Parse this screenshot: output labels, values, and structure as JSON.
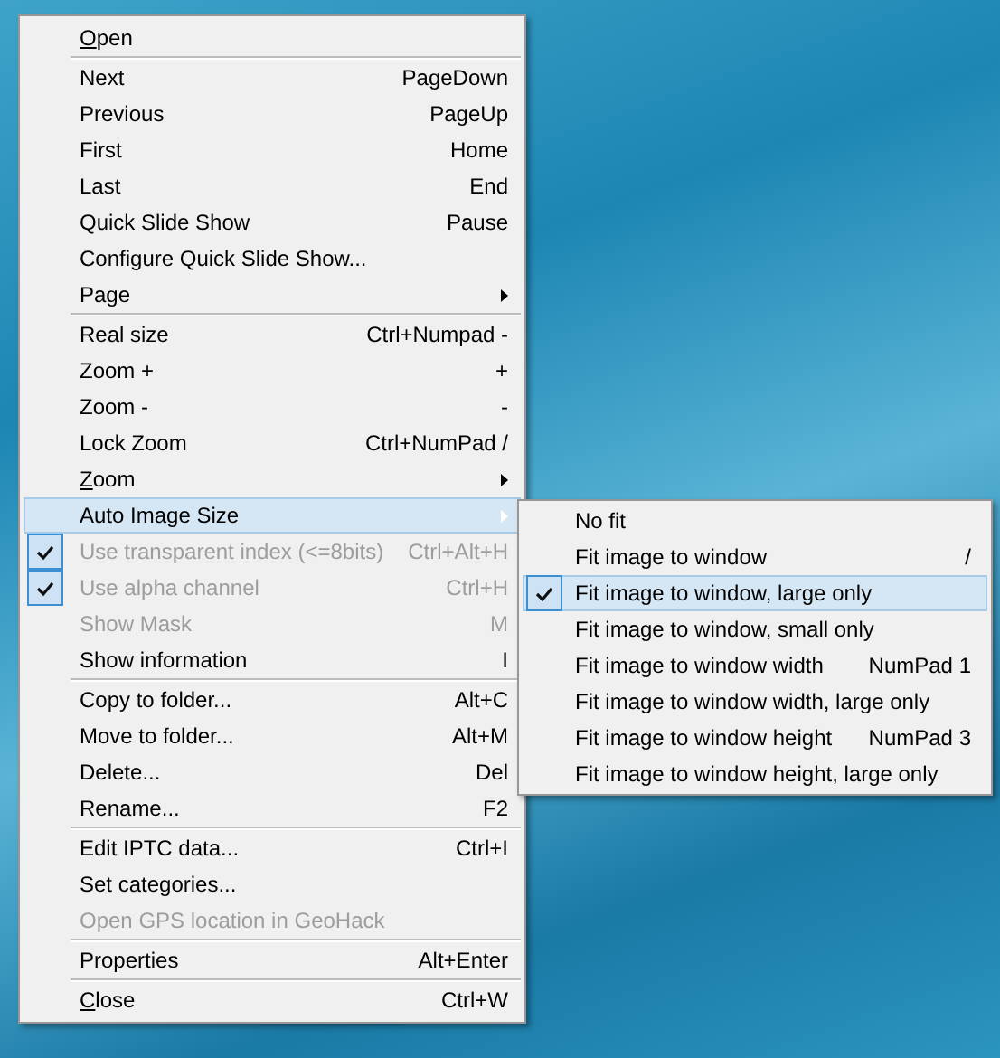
{
  "context_menu": {
    "items": [
      {
        "kind": "item",
        "label": "Open",
        "mnemonic": true,
        "selected": false
      },
      {
        "kind": "separator"
      },
      {
        "kind": "item",
        "label": "Next",
        "shortcut": "PageDown",
        "selected": false
      },
      {
        "kind": "item",
        "label": "Previous",
        "shortcut": "PageUp",
        "selected": false
      },
      {
        "kind": "item",
        "label": "First",
        "shortcut": "Home",
        "selected": false
      },
      {
        "kind": "item",
        "label": "Last",
        "shortcut": "End",
        "selected": false
      },
      {
        "kind": "item",
        "label": "Quick Slide Show",
        "shortcut": "Pause",
        "selected": false
      },
      {
        "kind": "item",
        "label": "Configure Quick Slide Show...",
        "selected": false
      },
      {
        "kind": "item",
        "label": "Page",
        "submenu": true,
        "selected": false
      },
      {
        "kind": "separator"
      },
      {
        "kind": "item",
        "label": "Real size",
        "shortcut": "Ctrl+Numpad -",
        "selected": false
      },
      {
        "kind": "item",
        "label": "Zoom +",
        "shortcut": "+",
        "selected": false
      },
      {
        "kind": "item",
        "label": "Zoom -",
        "shortcut": "-",
        "selected": false
      },
      {
        "kind": "item",
        "label": "Lock Zoom",
        "shortcut": "Ctrl+NumPad /",
        "selected": false
      },
      {
        "kind": "item",
        "label": "Zoom",
        "mnemonic": true,
        "submenu": true,
        "selected": false
      },
      {
        "kind": "item",
        "label": "Auto Image Size",
        "submenu": true,
        "selected": true
      },
      {
        "kind": "item",
        "label": "Use transparent index (<=8bits)",
        "shortcut": "Ctrl+Alt+H",
        "checked": true,
        "disabled": true,
        "selected": false
      },
      {
        "kind": "item",
        "label": "Use alpha channel",
        "shortcut": "Ctrl+H",
        "checked": true,
        "disabled": true,
        "selected": false
      },
      {
        "kind": "item",
        "label": "Show Mask",
        "shortcut": "M",
        "disabled": true,
        "selected": false
      },
      {
        "kind": "item",
        "label": "Show information",
        "shortcut": "I",
        "selected": false
      },
      {
        "kind": "separator"
      },
      {
        "kind": "item",
        "label": "Copy to folder...",
        "shortcut": "Alt+C",
        "selected": false
      },
      {
        "kind": "item",
        "label": "Move to folder...",
        "shortcut": "Alt+M",
        "selected": false
      },
      {
        "kind": "item",
        "label": "Delete...",
        "shortcut": "Del",
        "selected": false
      },
      {
        "kind": "item",
        "label": "Rename...",
        "shortcut": "F2",
        "selected": false
      },
      {
        "kind": "separator"
      },
      {
        "kind": "item",
        "label": "Edit IPTC data...",
        "shortcut": "Ctrl+I",
        "selected": false
      },
      {
        "kind": "item",
        "label": "Set categories...",
        "selected": false
      },
      {
        "kind": "item",
        "label": "Open GPS location in GeoHack",
        "disabled": true,
        "selected": false
      },
      {
        "kind": "separator"
      },
      {
        "kind": "item",
        "label": "Properties",
        "shortcut": "Alt+Enter",
        "selected": false
      },
      {
        "kind": "separator"
      },
      {
        "kind": "item",
        "label": "Close",
        "mnemonic": true,
        "shortcut": "Ctrl+W",
        "selected": false
      }
    ]
  },
  "submenu": {
    "items": [
      {
        "kind": "item",
        "label": "No fit",
        "selected": false
      },
      {
        "kind": "item",
        "label": "Fit image to window",
        "shortcut": "/",
        "selected": false
      },
      {
        "kind": "item",
        "label": "Fit image to window, large only",
        "checked": true,
        "selected": true
      },
      {
        "kind": "item",
        "label": "Fit image to window, small only",
        "selected": false
      },
      {
        "kind": "item",
        "label": "Fit image to window width",
        "shortcut": "NumPad 1",
        "selected": false
      },
      {
        "kind": "item",
        "label": "Fit image to window width, large only",
        "selected": false
      },
      {
        "kind": "item",
        "label": "Fit image to window height",
        "shortcut": "NumPad 3",
        "selected": false
      },
      {
        "kind": "item",
        "label": "Fit image to window height, large only",
        "selected": false
      }
    ]
  }
}
